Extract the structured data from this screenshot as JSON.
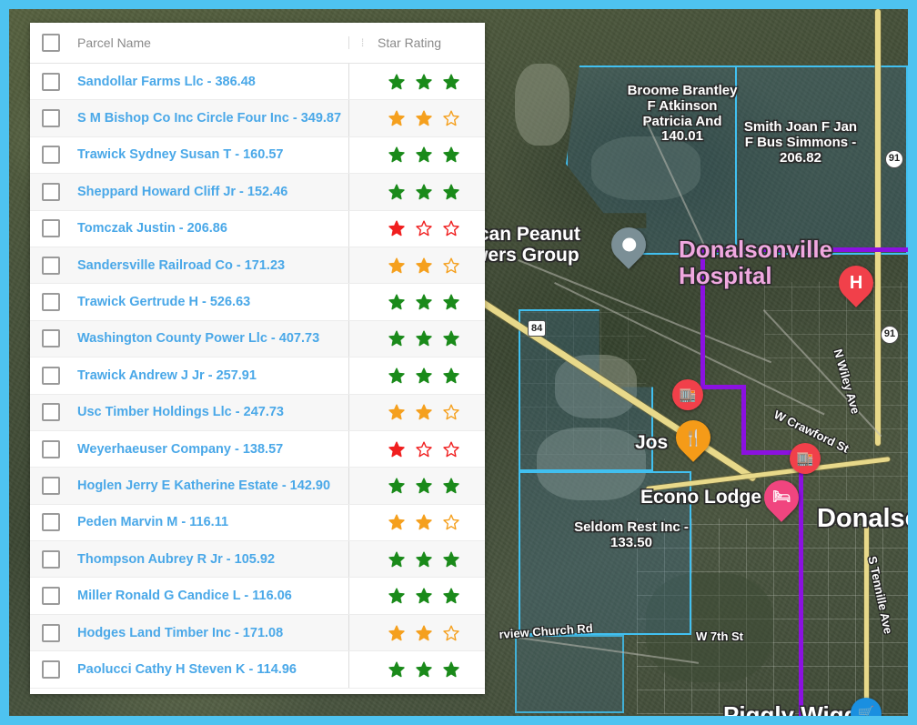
{
  "frame": {
    "border_color": "#4ec3f0"
  },
  "panel": {
    "columns": {
      "checkbox_header": "",
      "name": "Parcel Name",
      "divider_grip": "⁞",
      "rating": "Star Rating"
    },
    "rows": [
      {
        "name": "Sandollar Farms Llc - 386.48",
        "filled": 3,
        "total": 3,
        "color": "#1a8a1a"
      },
      {
        "name": "S M Bishop Co Inc Circle Four Inc - 349.87",
        "filled": 2,
        "total": 3,
        "color": "#f5a01e"
      },
      {
        "name": "Trawick Sydney Susan T - 160.57",
        "filled": 3,
        "total": 3,
        "color": "#1a8a1a"
      },
      {
        "name": "Sheppard Howard Cliff Jr - 152.46",
        "filled": 3,
        "total": 3,
        "color": "#1a8a1a"
      },
      {
        "name": "Tomczak Justin - 206.86",
        "filled": 1,
        "total": 3,
        "color": "#f01f1f"
      },
      {
        "name": "Sandersville Railroad Co - 171.23",
        "filled": 2,
        "total": 3,
        "color": "#f5a01e"
      },
      {
        "name": "Trawick Gertrude H - 526.63",
        "filled": 3,
        "total": 3,
        "color": "#1a8a1a"
      },
      {
        "name": "Washington County Power Llc - 407.73",
        "filled": 3,
        "total": 3,
        "color": "#1a8a1a"
      },
      {
        "name": "Trawick Andrew J Jr - 257.91",
        "filled": 3,
        "total": 3,
        "color": "#1a8a1a"
      },
      {
        "name": "Usc Timber Holdings Llc - 247.73",
        "filled": 2,
        "total": 3,
        "color": "#f5a01e"
      },
      {
        "name": "Weyerhaeuser Company - 138.57",
        "filled": 1,
        "total": 3,
        "color": "#f01f1f"
      },
      {
        "name": "Hoglen Jerry E Katherine Estate - 142.90",
        "filled": 3,
        "total": 3,
        "color": "#1a8a1a"
      },
      {
        "name": "Peden Marvin M - 116.11",
        "filled": 2,
        "total": 3,
        "color": "#f5a01e"
      },
      {
        "name": "Thompson Aubrey R Jr - 105.92",
        "filled": 3,
        "total": 3,
        "color": "#1a8a1a"
      },
      {
        "name": "Miller Ronald G Candice L - 116.06",
        "filled": 3,
        "total": 3,
        "color": "#1a8a1a"
      },
      {
        "name": "Hodges Land Timber Inc - 171.08",
        "filled": 2,
        "total": 3,
        "color": "#f5a01e"
      },
      {
        "name": "Paolucci Cathy H Steven K - 114.96",
        "filled": 3,
        "total": 3,
        "color": "#1a8a1a"
      }
    ]
  },
  "map": {
    "parcel_labels": [
      {
        "text": "Broome Brantley\nF Atkinson\nPatricia And\n140.01"
      },
      {
        "text": "Smith Joan F Jan\nF Bus Simmons -\n206.82"
      },
      {
        "text": "Seldom Rest Inc -\n133.50"
      }
    ],
    "poi_labels": [
      {
        "text": "ican Peanut\nwers Group"
      },
      {
        "text": "Donalsonville Hospital"
      },
      {
        "text": "Jos"
      },
      {
        "text": "Econo Lodge"
      },
      {
        "text": "Donalson"
      },
      {
        "text": "Piggly Wiggly"
      }
    ],
    "road_labels": [
      {
        "text": "N Wiley Ave"
      },
      {
        "text": "W Crawford St"
      },
      {
        "text": "S Tennille Ave"
      },
      {
        "text": "W 7th St"
      },
      {
        "text": "rview Church Rd"
      }
    ],
    "shields": [
      {
        "text": "84"
      },
      {
        "text": "91"
      },
      {
        "text": "91"
      }
    ],
    "markers": [
      {
        "icon": "map-pin-icon",
        "glyph": ""
      },
      {
        "icon": "hospital-pin-icon",
        "glyph": "H"
      },
      {
        "icon": "restaurant-pin-icon",
        "glyph": "🍴"
      },
      {
        "icon": "lodging-pin-icon",
        "glyph": "🛏"
      },
      {
        "icon": "building-marker-icon",
        "glyph": "🏢"
      },
      {
        "icon": "building-marker-icon",
        "glyph": "🏢"
      },
      {
        "icon": "shopping-cart-icon",
        "glyph": "🛒"
      }
    ],
    "route_color": "#8b11e0",
    "parcel_outline_color": "#41c0f0"
  }
}
